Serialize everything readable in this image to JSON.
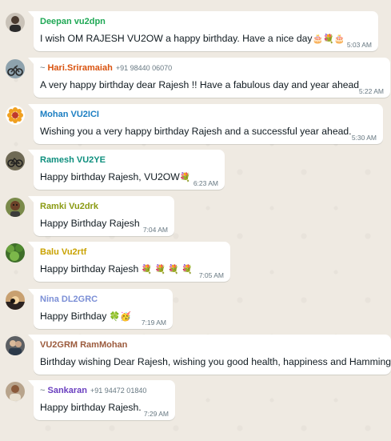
{
  "messages": [
    {
      "sender": "Deepan vu2dpn",
      "phone": "",
      "tilde": false,
      "color": "#1fa855",
      "text": "I wish OM RAJESH VU2OW  a happy birthday. Have a nice day",
      "emoji": "🎂💐🎂",
      "time": "5:03 AM",
      "avatar": "man-portrait"
    },
    {
      "sender": "Hari.Sriramaiah",
      "phone": "+91 98440 06070",
      "tilde": true,
      "color": "#d9530f",
      "text": "A very happy birthday dear Rajesh !! Have a fabulous day and year ahead",
      "emoji": "",
      "time": "5:22 AM",
      "avatar": "motorcycle"
    },
    {
      "sender": "Mohan VU2ICI",
      "phone": "",
      "tilde": false,
      "color": "#1b7ec2",
      "text": "Wishing you a very happy birthday Rajesh  and a successful year ahead.",
      "emoji": "",
      "time": "5:30 AM",
      "avatar": "sun-flower"
    },
    {
      "sender": "Ramesh VU2YE",
      "phone": "",
      "tilde": false,
      "color": "#0e8f7e",
      "text": "Happy birthday Rajesh, VU2OW",
      "emoji": "💐",
      "time": "6:23 AM",
      "avatar": "bicycle"
    },
    {
      "sender": "Ramki Vu2drk",
      "phone": "",
      "tilde": false,
      "color": "#8a9a12",
      "text": "Happy Birthday Rajesh",
      "emoji": "",
      "time": "7:04 AM",
      "avatar": "man-portrait"
    },
    {
      "sender": "Balu Vu2rtf",
      "phone": "",
      "tilde": false,
      "color": "#c9a200",
      "text": "Happy birthday Rajesh",
      "emoji": "💐 💐 💐 💐",
      "time": "7:05 AM",
      "avatar": "green-leaves"
    },
    {
      "sender": "Nina DL2GRC",
      "phone": "",
      "tilde": false,
      "color": "#7b8fd6",
      "text": "Happy Birthday",
      "emoji": "🍀🥳",
      "time": "7:19 AM",
      "avatar": "sunset"
    },
    {
      "sender": "VU2GRM RamMohan",
      "phone": "",
      "tilde": false,
      "color": "#9b5a3c",
      "text": "Birthday wishing Dear Rajesh, wishing you good health, happiness and Hamming..",
      "emoji": "",
      "time": "",
      "avatar": "man-portrait"
    },
    {
      "sender": "Sankaran",
      "phone": "+91 94472 01840",
      "tilde": true,
      "color": "#6a3fbf",
      "text": "Happy birthday Rajesh.",
      "emoji": "",
      "time": "7:29 AM",
      "avatar": "man-portrait"
    }
  ]
}
